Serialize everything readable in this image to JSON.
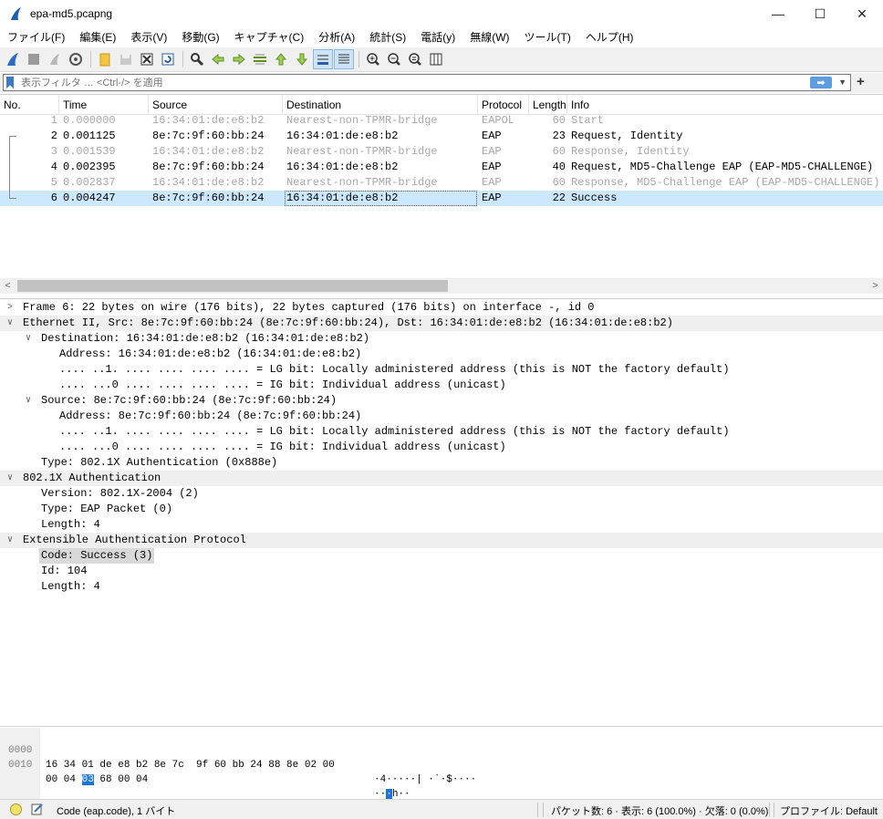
{
  "window": {
    "title": "epa-md5.pcapng",
    "minimize": "—",
    "maximize": "☐",
    "close": "✕"
  },
  "menu": [
    "ファイル(F)",
    "編集(E)",
    "表示(V)",
    "移動(G)",
    "キャプチャ(C)",
    "分析(A)",
    "統計(S)",
    "電話(y)",
    "無線(W)",
    "ツール(T)",
    "ヘルプ(H)"
  ],
  "filter": {
    "placeholder": "表示フィルタ … <Ctrl-/> を適用",
    "value": ""
  },
  "packet_list": {
    "columns": [
      "No.",
      "Time",
      "Source",
      "Destination",
      "Protocol",
      "Length",
      "Info"
    ],
    "rows": [
      {
        "no": "1",
        "time": "0.000000",
        "source": "16:34:01:de:e8:b2",
        "destination": "Nearest-non-TPMR-bridge",
        "protocol": "EAPOL",
        "length": "60",
        "info": "Start"
      },
      {
        "no": "2",
        "time": "0.001125",
        "source": "8e:7c:9f:60:bb:24",
        "destination": "16:34:01:de:e8:b2",
        "protocol": "EAP",
        "length": "23",
        "info": "Request, Identity"
      },
      {
        "no": "3",
        "time": "0.001539",
        "source": "16:34:01:de:e8:b2",
        "destination": "Nearest-non-TPMR-bridge",
        "protocol": "EAP",
        "length": "60",
        "info": "Response, Identity"
      },
      {
        "no": "4",
        "time": "0.002395",
        "source": "8e:7c:9f:60:bb:24",
        "destination": "16:34:01:de:e8:b2",
        "protocol": "EAP",
        "length": "40",
        "info": "Request, MD5-Challenge EAP (EAP-MD5-CHALLENGE)"
      },
      {
        "no": "5",
        "time": "0.002837",
        "source": "16:34:01:de:e8:b2",
        "destination": "Nearest-non-TPMR-bridge",
        "protocol": "EAP",
        "length": "60",
        "info": "Response, MD5-Challenge EAP (EAP-MD5-CHALLENGE)"
      },
      {
        "no": "6",
        "time": "0.004247",
        "source": "8e:7c:9f:60:bb:24",
        "destination": "16:34:01:de:e8:b2",
        "protocol": "EAP",
        "length": "22",
        "info": "Success"
      }
    ]
  },
  "details": [
    "Frame 6: 22 bytes on wire (176 bits), 22 bytes captured (176 bits) on interface -, id 0",
    "Ethernet II, Src: 8e:7c:9f:60:bb:24 (8e:7c:9f:60:bb:24), Dst: 16:34:01:de:e8:b2 (16:34:01:de:e8:b2)",
    "Destination: 16:34:01:de:e8:b2 (16:34:01:de:e8:b2)",
    "Address: 16:34:01:de:e8:b2 (16:34:01:de:e8:b2)",
    ".... ..1. .... .... .... .... = LG bit: Locally administered address (this is NOT the factory default)",
    ".... ...0 .... .... .... .... = IG bit: Individual address (unicast)",
    "Source: 8e:7c:9f:60:bb:24 (8e:7c:9f:60:bb:24)",
    "Address: 8e:7c:9f:60:bb:24 (8e:7c:9f:60:bb:24)",
    ".... ..1. .... .... .... .... = LG bit: Locally administered address (this is NOT the factory default)",
    ".... ...0 .... .... .... .... = IG bit: Individual address (unicast)",
    "Type: 802.1X Authentication (0x888e)",
    "802.1X Authentication",
    "Version: 802.1X-2004 (2)",
    "Type: EAP Packet (0)",
    "Length: 4",
    "Extensible Authentication Protocol",
    "Code: Success (3)",
    "Id: 104",
    "Length: 4"
  ],
  "bytes": {
    "offsets": [
      "0000",
      "0010"
    ],
    "line1_hex": "16 34 01 de e8 b2 8e 7c  9f 60 bb 24 88 8e 02 00",
    "line1_ascii": "·4·····| ·`·$····",
    "line2_hex_pre": "00 04 ",
    "line2_hex_hl": "03",
    "line2_hex_post": " 68 00 04",
    "line2_ascii_pre": "··",
    "line2_ascii_hl": "·",
    "line2_ascii_post": "h··"
  },
  "status": {
    "field": "Code (eap.code), 1 バイト",
    "packets": "パケット数: 6 · 表示: 6 (100.0%) · 欠落: 0 (0.0%)",
    "profile": "プロファイル: Default"
  },
  "colors": {
    "selected_row": "#cce8ff",
    "dimmed_text": "#a8a8a8",
    "band": "#efefef",
    "byte_highlight": "#1c74d6"
  }
}
